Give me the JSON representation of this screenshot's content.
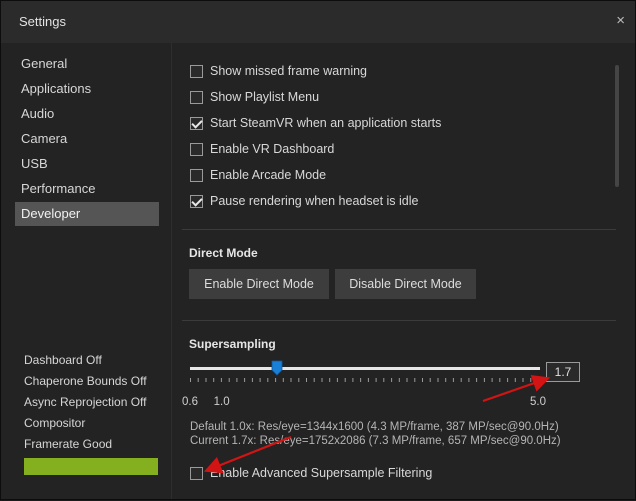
{
  "window": {
    "title": "Settings",
    "close_glyph": "×"
  },
  "sidebar": {
    "items": [
      {
        "label": "General"
      },
      {
        "label": "Applications"
      },
      {
        "label": "Audio"
      },
      {
        "label": "Camera"
      },
      {
        "label": "USB"
      },
      {
        "label": "Performance"
      },
      {
        "label": "Developer",
        "selected": true
      }
    ],
    "status": [
      {
        "label": "Dashboard Off"
      },
      {
        "label": "Chaperone Bounds Off"
      },
      {
        "label": "Async Reprojection Off"
      },
      {
        "label": "Compositor"
      },
      {
        "label": "Framerate Good"
      }
    ],
    "framerate_bar_color": "#84b01f"
  },
  "developer": {
    "options": [
      {
        "label": "Show missed frame warning",
        "checked": false
      },
      {
        "label": "Show Playlist Menu",
        "checked": false
      },
      {
        "label": "Start SteamVR when an application starts",
        "checked": true
      },
      {
        "label": "Enable VR Dashboard",
        "checked": false
      },
      {
        "label": "Enable Arcade Mode",
        "checked": false
      },
      {
        "label": "Pause rendering when headset is idle",
        "checked": true
      }
    ],
    "direct_mode": {
      "title": "Direct Mode",
      "enable_label": "Enable Direct Mode",
      "disable_label": "Disable Direct Mode"
    },
    "supersampling": {
      "title": "Supersampling",
      "min": 0.6,
      "max": 5.0,
      "value": 1.7,
      "value_text": "1.7",
      "tick_labels": [
        {
          "label": "0.6",
          "value": 0.6
        },
        {
          "label": "1.0",
          "value": 1.0
        },
        {
          "label": "5.0",
          "value": 5.0
        }
      ],
      "default_info": "Default 1.0x: Res/eye=1344x1600 (4.3 MP/frame, 387 MP/sec@90.0Hz)",
      "current_info": "Current 1.7x: Res/eye=1752x2086 (7.3 MP/frame, 657 MP/sec@90.0Hz)",
      "advanced_filtering": {
        "label": "Enable Advanced Supersample Filtering",
        "checked": false
      },
      "thumb_color": "#1a7fd6"
    },
    "annotation_color": "#d21414"
  }
}
